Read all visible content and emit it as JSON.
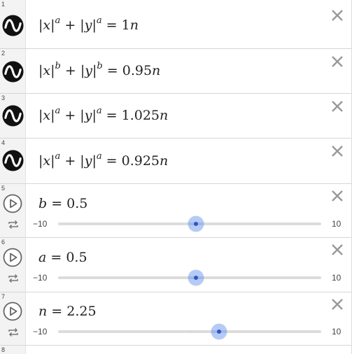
{
  "expressions": [
    {
      "index": "1",
      "lhs1": "x",
      "exp1": "a",
      "lhs2": "y",
      "exp2": "a",
      "rhs_num": "1",
      "rhs_var": "n",
      "icon": "curve-icon"
    },
    {
      "index": "2",
      "lhs1": "x",
      "exp1": "b",
      "lhs2": "y",
      "exp2": "b",
      "rhs_num": "0.95",
      "rhs_var": "n",
      "icon": "curve-icon"
    },
    {
      "index": "3",
      "lhs1": "x",
      "exp1": "a",
      "lhs2": "y",
      "exp2": "a",
      "rhs_num": "1.025",
      "rhs_var": "n",
      "icon": "curve-icon"
    },
    {
      "index": "4",
      "lhs1": "x",
      "exp1": "a",
      "lhs2": "y",
      "exp2": "a",
      "rhs_num": "0.925",
      "rhs_var": "n",
      "icon": "curve-icon"
    }
  ],
  "sliders": [
    {
      "index": "5",
      "var": "b",
      "value": "0.5",
      "min": "−10",
      "max": "10",
      "numeric_value": 0.5
    },
    {
      "index": "6",
      "var": "a",
      "value": "0.5",
      "min": "−10",
      "max": "10",
      "numeric_value": 0.5
    },
    {
      "index": "7",
      "var": "n",
      "value": "2.25",
      "min": "−10",
      "max": "10",
      "numeric_value": 2.25
    }
  ],
  "empty_row": {
    "index": "8"
  },
  "colors": {
    "thumb": "#2a58c9",
    "halo": "#5a8ceb",
    "track": "#dcdcdc"
  }
}
